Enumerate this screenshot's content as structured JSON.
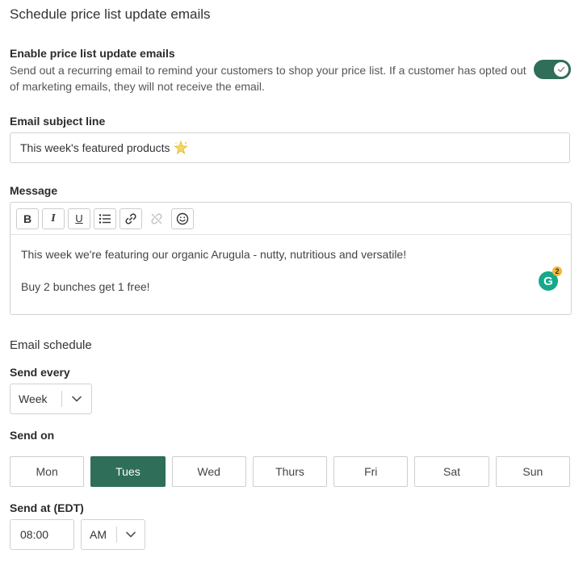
{
  "page_title": "Schedule price list update emails",
  "enable": {
    "heading": "Enable price list update emails",
    "description": "Send out a recurring email to remind your customers to shop your price list. If a customer has opted out of marketing emails, they will not receive the email.",
    "enabled": true
  },
  "subject": {
    "label": "Email subject line",
    "value": "This week's featured products",
    "icon": "sparkle-icon"
  },
  "message": {
    "label": "Message",
    "toolbar": {
      "bold": "B",
      "italic": "I",
      "underline": "U",
      "icons": [
        "bullet-list-icon",
        "link-icon",
        "unlink-icon",
        "emoji-icon"
      ]
    },
    "lines": [
      "This week we're featuring our organic Arugula - nutty, nutritious and versatile!",
      "Buy 2 bunches get 1 free!"
    ],
    "grammarly_badge": "2"
  },
  "schedule": {
    "title": "Email schedule",
    "send_every_label": "Send every",
    "send_every_value": "Week",
    "send_on_label": "Send on",
    "days": [
      "Mon",
      "Tues",
      "Wed",
      "Thurs",
      "Fri",
      "Sat",
      "Sun"
    ],
    "selected_day": "Tues",
    "send_at_label": "Send at (EDT)",
    "time_value": "08:00",
    "ampm_value": "AM"
  },
  "colors": {
    "accent": "#2f6e59",
    "grammarly": "#15a88a",
    "badge": "#f5b731"
  }
}
